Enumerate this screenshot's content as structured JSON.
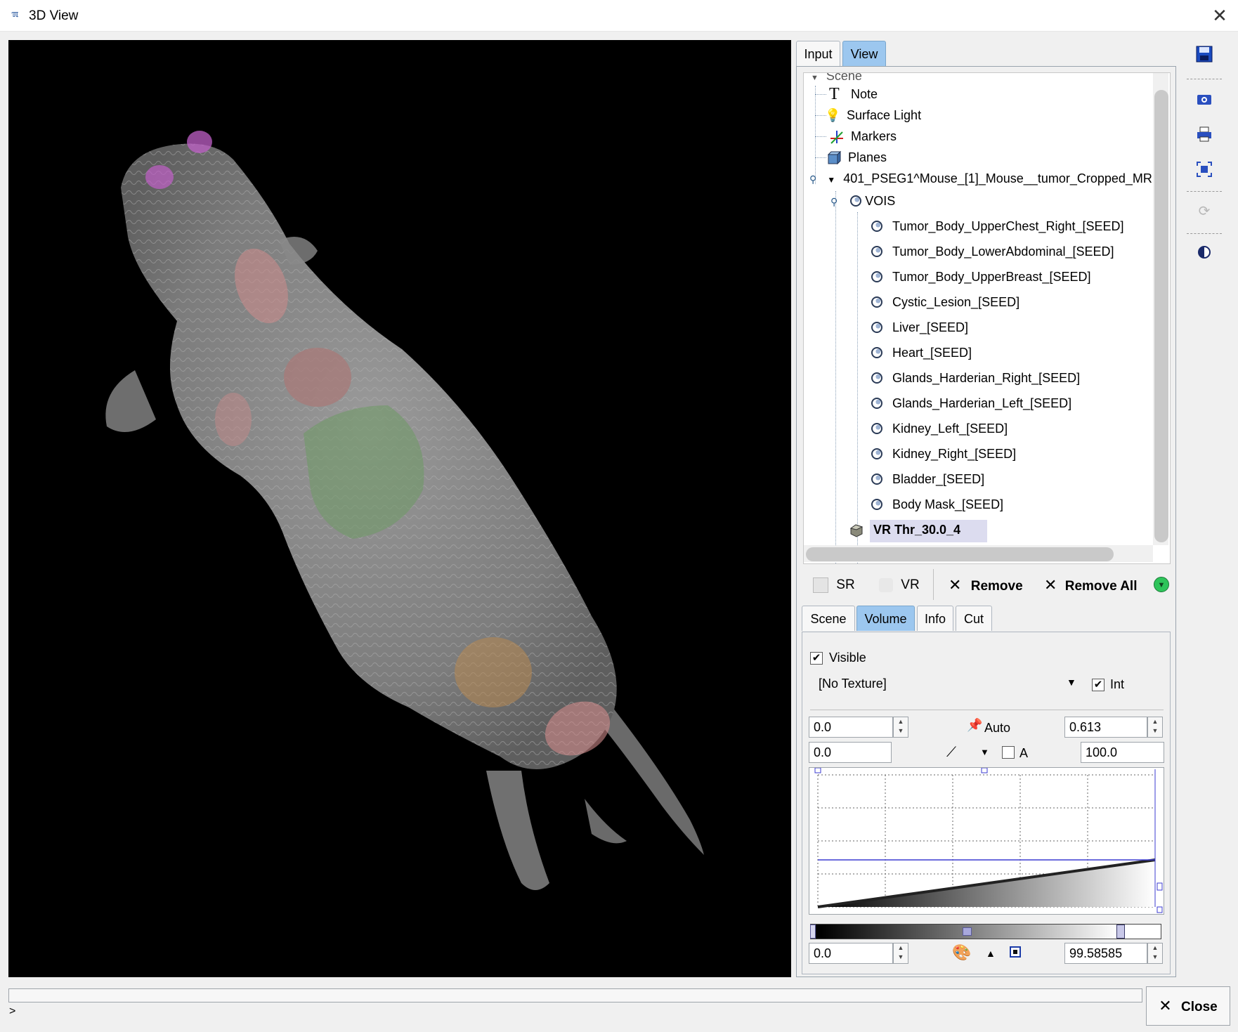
{
  "window": {
    "title": "3D View",
    "icon": "app-logo-icon"
  },
  "tabs": {
    "input": "Input",
    "view": "View"
  },
  "tree": {
    "root_partial": "Scene",
    "items": {
      "note": "Note",
      "surface_light": "Surface Light",
      "markers": "Markers",
      "planes": "Planes"
    },
    "dataset": "401_PSEG1^Mouse_[1]_Mouse__tumor_Cropped_MR",
    "vois_label": "VOIS",
    "vois": [
      "Tumor_Body_UpperChest_Right_[SEED]",
      "Tumor_Body_LowerAbdominal_[SEED]",
      "Tumor_Body_UpperBreast_[SEED]",
      "Cystic_Lesion_[SEED]",
      "Liver_[SEED]",
      "Heart_[SEED]",
      "Glands_Harderian_Right_[SEED]",
      "Glands_Harderian_Left_[SEED]",
      "Kidney_Left_[SEED]",
      "Kidney_Right_[SEED]",
      "Bladder_[SEED]",
      "Body Mask_[SEED]"
    ],
    "selected": "VR Thr_30.0_4"
  },
  "toolbar": {
    "sr": "SR",
    "vr": "VR",
    "remove": "Remove",
    "remove_all": "Remove All"
  },
  "subtabs": {
    "scene": "Scene",
    "volume": "Volume",
    "info": "Info",
    "cut": "Cut"
  },
  "volume": {
    "visible_label": "Visible",
    "visible_checked": true,
    "texture": "[No Texture]",
    "int_label": "Int",
    "int_checked": true,
    "min_value": "0.0",
    "auto_label": "Auto",
    "max_value": "0.613",
    "lower_value": "0.0",
    "a_label": "A",
    "a_checked": false,
    "upper_value": "100.0",
    "range_min": "0.0",
    "range_max": "99.58585"
  },
  "colors": {
    "tab_active": "#9cc7ef",
    "selection": "#dcdcef",
    "curve": "#3b3bd0"
  },
  "status": {
    "prompt": ">"
  },
  "close_button": "Close"
}
